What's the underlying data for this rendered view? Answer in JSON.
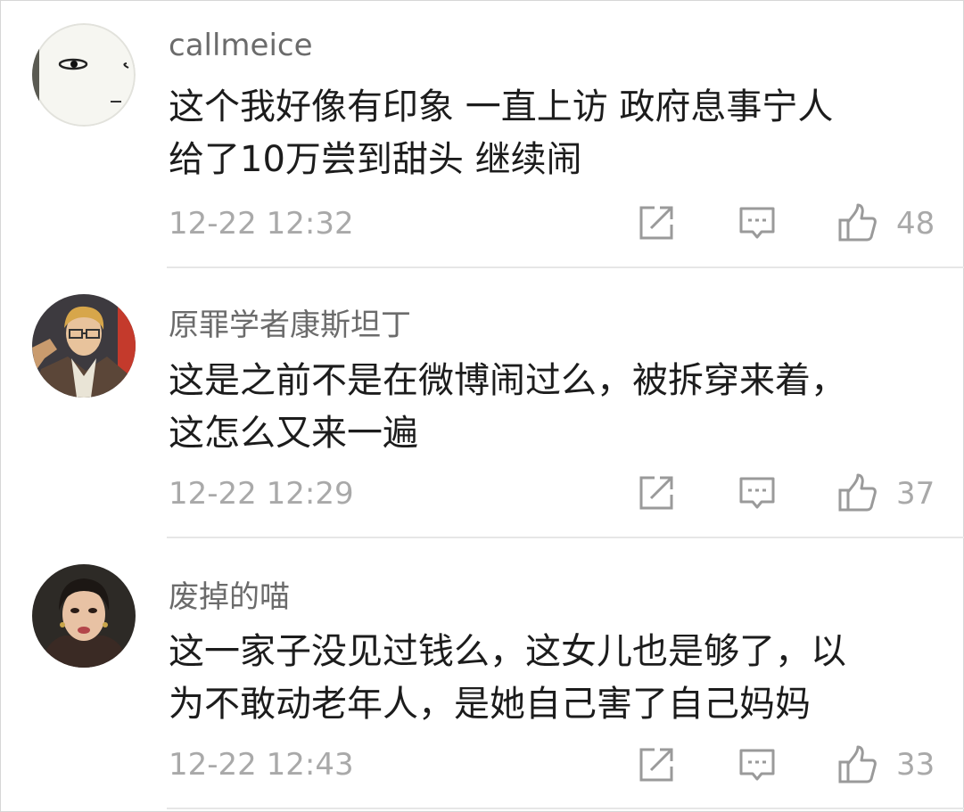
{
  "comments": [
    {
      "username": "callmeice",
      "lines": [
        "这个我好像有印象 一直上访 政府息事宁人",
        "给了10万尝到甜头 继续闹"
      ],
      "time": "12-22 12:32",
      "likes": "48",
      "avatar_icon": "stick-face-avatar"
    },
    {
      "username": "原罪学者康斯坦丁",
      "lines": [
        "这是之前不是在微博闹过么，被拆穿来着，",
        "这怎么又来一遍"
      ],
      "time": "12-22 12:29",
      "likes": "37",
      "avatar_icon": "illustrated-man-avatar"
    },
    {
      "username": "废掉的喵",
      "lines": [
        "这一家子没见过钱么，这女儿也是够了，以",
        "为不敢动老年人，是她自己害了自己妈妈"
      ],
      "time": "12-22 12:43",
      "likes": "33",
      "avatar_icon": "woman-photo-avatar"
    }
  ],
  "icons": {
    "share": "share-icon",
    "reply": "reply-icon",
    "like": "thumbs-up-icon"
  },
  "colors": {
    "username": "#6b6b6b",
    "content": "#1c1c1c",
    "meta": "#a9a9a9",
    "divider": "#e6e6e6"
  }
}
